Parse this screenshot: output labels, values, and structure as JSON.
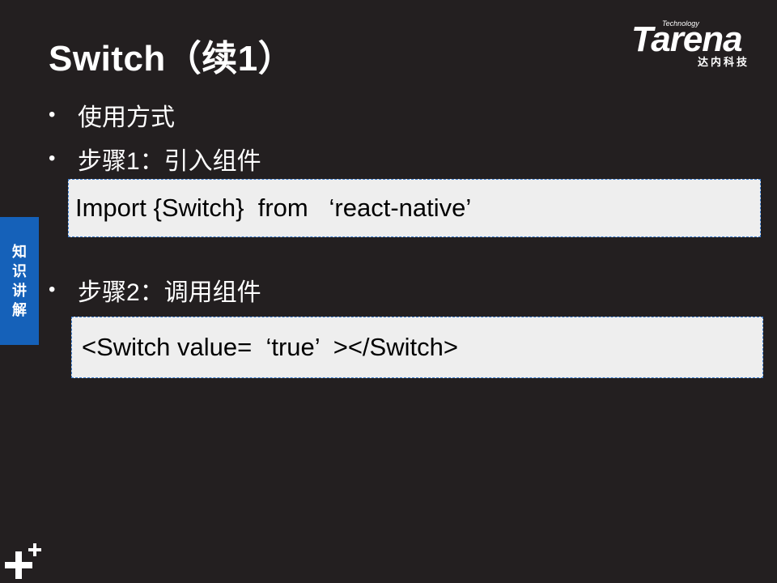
{
  "slide": {
    "title": "Switch（续1）",
    "bullets": [
      {
        "text": "使用方式"
      },
      {
        "text": "步骤1：引入组件"
      },
      {
        "text": "步骤2：调用组件"
      }
    ],
    "code_blocks": [
      "Import {Switch}  from   ‘react-native’",
      "<Switch value=  ‘true’  ></Switch>"
    ]
  },
  "logo": {
    "tagline": "Technology",
    "brand": "Tarena",
    "chinese": "达内科技"
  },
  "side_tab": {
    "chars": [
      "知",
      "识",
      "讲",
      "解"
    ]
  },
  "bullet_glyph": "•",
  "colors": {
    "background": "#231f20",
    "side_tab": "#1561b9",
    "code_box_bg": "#eeeeee",
    "code_box_border": "#3f7fcf"
  },
  "icons": {
    "bottom_left": "double-plus-icon"
  }
}
